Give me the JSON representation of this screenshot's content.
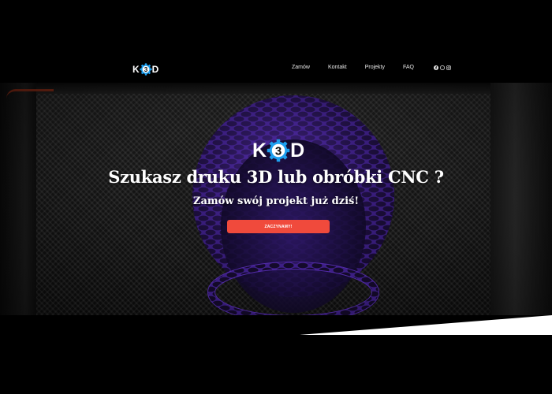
{
  "brand": {
    "logo_left": "K",
    "logo_middle": "3",
    "logo_right": "D",
    "accent_color": "#1ea0f0"
  },
  "nav": {
    "links": [
      "Zamów",
      "Kontakt",
      "Projekty",
      "FAQ"
    ],
    "social_icons": [
      "facebook-icon",
      "messenger-icon",
      "instagram-icon"
    ]
  },
  "hero": {
    "title": "Szukasz druku 3D lub obróbki CNC ?",
    "subtitle": "Zamów swój projekt już dziś!",
    "cta_label": "ZACZYNAMY!",
    "cta_color": "#f04a3c",
    "product_color": "#5a2fb8"
  }
}
